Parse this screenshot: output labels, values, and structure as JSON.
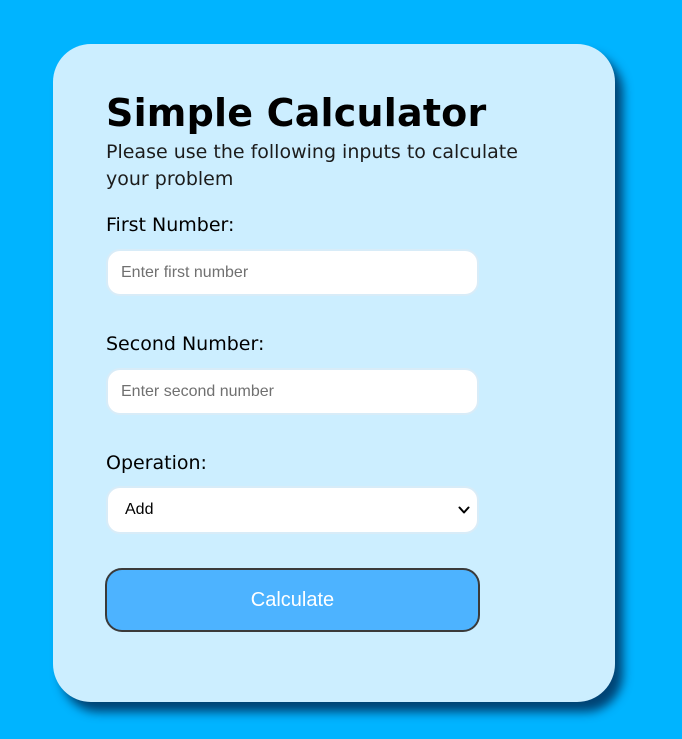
{
  "page": {
    "background_color": "#00b4ff",
    "card_color": "#cceeff",
    "accent_color": "#4db3ff"
  },
  "calculator": {
    "title": "Simple Calculator",
    "subtitle": "Please use the following inputs to calculate your problem",
    "first_number": {
      "label": "First Number:",
      "placeholder": "Enter first number",
      "value": ""
    },
    "second_number": {
      "label": "Second Number:",
      "placeholder": "Enter second number",
      "value": ""
    },
    "operation": {
      "label": "Operation:",
      "selected": "Add",
      "icon": "chevron-down-icon"
    },
    "calculate_label": "Calculate"
  }
}
